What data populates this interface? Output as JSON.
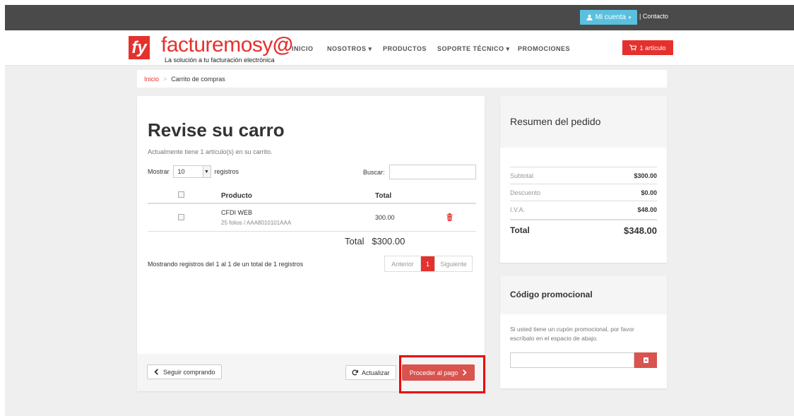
{
  "topbar": {
    "account_label": "Mi cuenta",
    "contact_label": "| Contacto"
  },
  "brand": {
    "logo_letters": "fy",
    "name": "facturemosy",
    "name_at": "@",
    "tagline": "La solución a tu facturación electrónica"
  },
  "nav": {
    "items": [
      "INICIO",
      "NOSOTROS ▾",
      "PRODUCTOS",
      "SOPORTE TÉCNICO ▾",
      "PROMOCIONES"
    ],
    "cart_label": "1 artículo"
  },
  "breadcrumb": {
    "home": "Inicio",
    "separator": ">",
    "current": "Carrito de compras"
  },
  "cart": {
    "title": "Revise su carro",
    "subtitle": "Actualmente tiene 1 artículo(s) en su carrito.",
    "show_label": "Mostrar",
    "page_size": "10",
    "records_label": "registros",
    "search_label": "Buscar:",
    "search_value": "",
    "columns": [
      "Producto",
      "Total"
    ],
    "rows": [
      {
        "name": "CFDI WEB",
        "desc": "25 folios / AAA8010101AAA",
        "total": "300.00"
      }
    ],
    "total_label": "Total",
    "total_value": "$300.00",
    "showing_text": "Mostrando registros del 1 al 1 de un total de 1 registros",
    "pager": {
      "prev": "Anterior",
      "current": "1",
      "next": "Siguiente"
    },
    "continue_label": "Seguir comprando",
    "update_label": "Actualizar",
    "pay_label": "Proceder al pago"
  },
  "summary": {
    "title": "Resumen del pedido",
    "rows": [
      {
        "label": "Subtotal",
        "value": "$300.00"
      },
      {
        "label": "Descuento",
        "value": "$0.00"
      },
      {
        "label": "I.V.A.",
        "value": "$48.00"
      }
    ],
    "total_label": "Total",
    "total_value": "$348.00"
  },
  "promo": {
    "title": "Código promocional",
    "text": "Si usted tiene un cupón promocional, por favor escríbalo en el espacio de abajo.",
    "input_value": ""
  },
  "colors": {
    "brand_red": "#e4312e",
    "accent_blue": "#5bc0de",
    "button_red": "#d9534f",
    "topbar": "#4a4a4a",
    "highlight": "#ee0000"
  }
}
